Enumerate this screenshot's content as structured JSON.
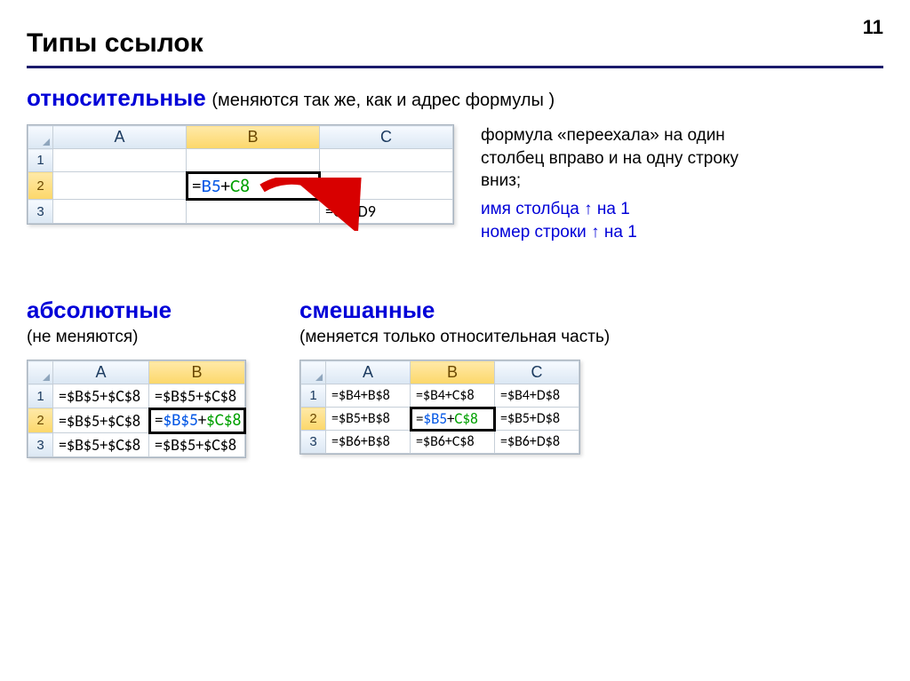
{
  "pageNumber": "11",
  "title": "Типы ссылок",
  "sec1": {
    "label": "относительные",
    "sub": "(меняются так же, как и адрес формулы )",
    "side1": "формула «переехала» на один столбец вправо и на одну строку вниз;",
    "side2a": "имя столбца ",
    "side2b": " на 1",
    "side3a": "номер строки ",
    "side3b": " на 1"
  },
  "sheet1": {
    "cols": [
      "A",
      "B",
      "C"
    ],
    "rows": [
      "1",
      "2",
      "3"
    ],
    "b2": {
      "pre": "=",
      "r1": "B5",
      "mid": "+",
      "r2": "C8"
    },
    "c3": "=C6+D9"
  },
  "sec2": {
    "label": "абсолютные",
    "sub": "(не меняются)"
  },
  "sheet2": {
    "cols": [
      "A",
      "B"
    ],
    "rows": [
      "1",
      "2",
      "3"
    ],
    "a1": "=$B$5+$C$8",
    "b1": "=$B$5+$C$8",
    "a2": "=$B$5+$C$8",
    "b2": {
      "pre": "=",
      "r1": "$B$5",
      "mid": "+",
      "r2": "$C$8"
    },
    "a3": "=$B$5+$C$8",
    "b3": "=$B$5+$C$8"
  },
  "sec3": {
    "label": "смешанные",
    "sub": "(меняется только относительная часть)"
  },
  "sheet3": {
    "cols": [
      "A",
      "B",
      "C"
    ],
    "rows": [
      "1",
      "2",
      "3"
    ],
    "a1": "=$B4+B$8",
    "b1": "=$B4+C$8",
    "c1": "=$B4+D$8",
    "a2": "=$B5+B$8",
    "b2": {
      "pre": "=",
      "r1": "$B5",
      "mid": "+",
      "r2": "C$8"
    },
    "c2": "=$B5+D$8",
    "a3": "=$B6+B$8",
    "b3": "=$B6+C$8",
    "c3": "=$B6+D$8"
  }
}
